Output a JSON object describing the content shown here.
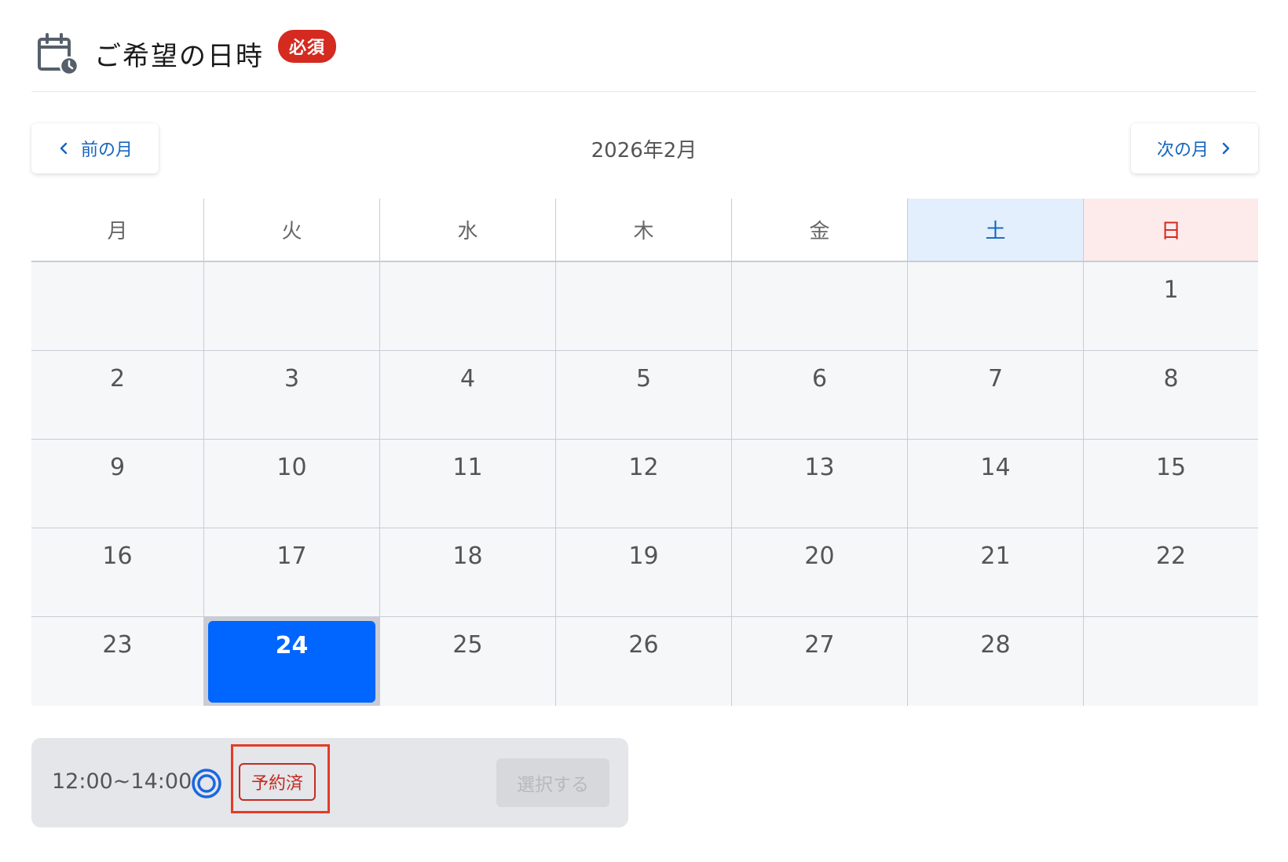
{
  "header": {
    "title": "ご希望の日時",
    "required_badge": "必須",
    "icon": "calendar-clock-icon"
  },
  "nav": {
    "prev_label": "前の月",
    "next_label": "次の月",
    "month_label": "2026年2月"
  },
  "weekdays": [
    "月",
    "火",
    "水",
    "木",
    "金",
    "土",
    "日"
  ],
  "weeks": [
    [
      "",
      "",
      "",
      "",
      "",
      "",
      "1"
    ],
    [
      "2",
      "3",
      "4",
      "5",
      "6",
      "7",
      "8"
    ],
    [
      "9",
      "10",
      "11",
      "12",
      "13",
      "14",
      "15"
    ],
    [
      "16",
      "17",
      "18",
      "19",
      "20",
      "21",
      "22"
    ],
    [
      "23",
      "24",
      "25",
      "26",
      "27",
      "28",
      ""
    ]
  ],
  "selected_day": "24",
  "slot": {
    "time": "12:00~14:00",
    "availability_icon": "double-circle-icon",
    "status_badge": "予約済",
    "select_label": "選択する"
  },
  "colors": {
    "accent": "#0066ff",
    "link": "#1565c0",
    "required": "#d42a20",
    "saturday_bg": "#e3effc",
    "sunday_bg": "#fdeaea"
  }
}
